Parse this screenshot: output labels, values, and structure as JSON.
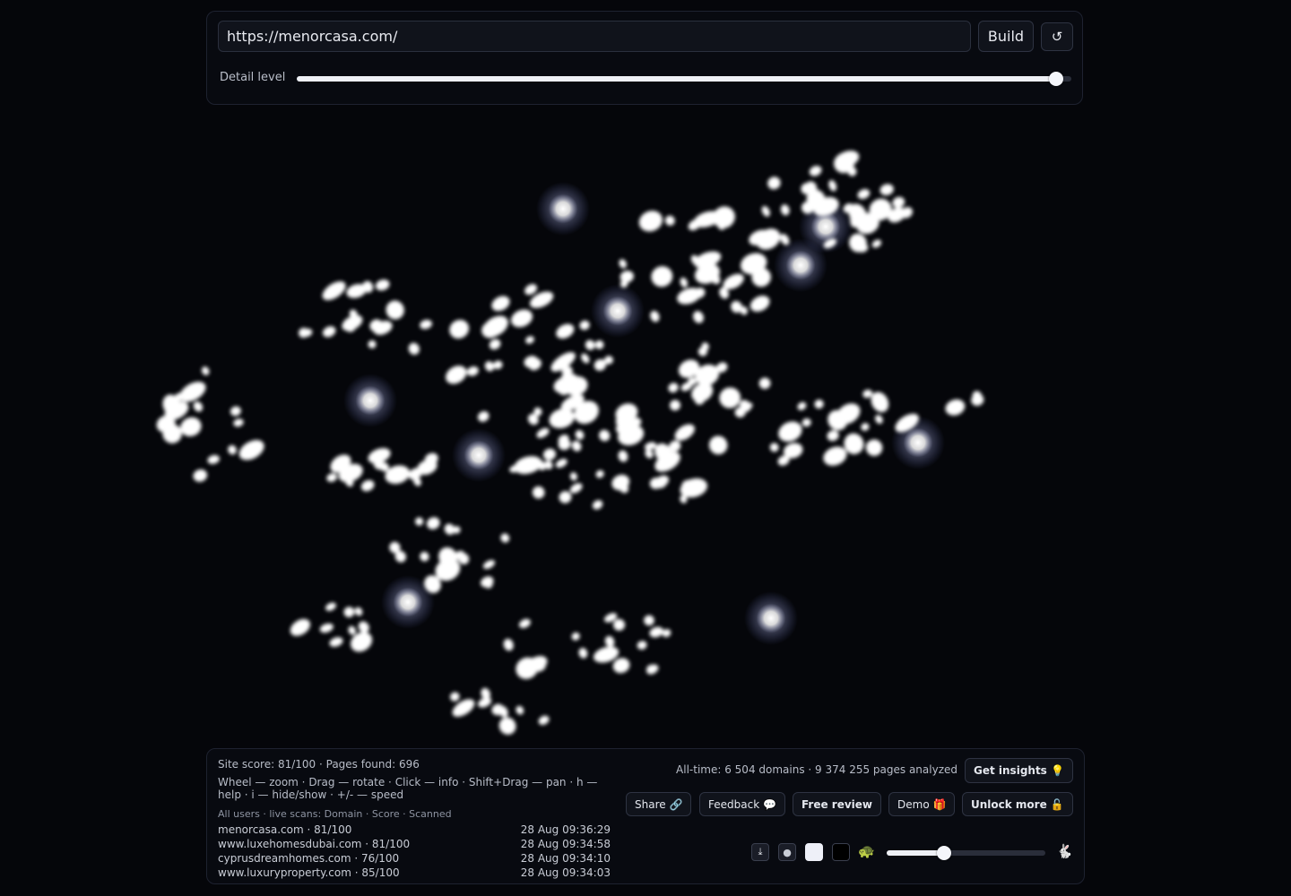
{
  "url_bar": {
    "value": "https://menorcasa.com/"
  },
  "toolbar": {
    "build_label": "Build",
    "refresh_icon": "↺"
  },
  "detail": {
    "label": "Detail level",
    "level": 0.98
  },
  "stats": {
    "site_score": "Site score: 81/100 · Pages found: 696",
    "help": "Wheel — zoom · Drag — rotate · Click — info · Shift+Drag — pan · h — help · i — hide/show · +/- — speed",
    "all_time": "All-time: 6 504 domains · 9 374 255 pages analyzed"
  },
  "scans": {
    "header": "All users · live scans: Domain · Score · Scanned",
    "rows": [
      {
        "domain": "menorcasa.com · 81/100",
        "time": "28 Aug 09:36:29"
      },
      {
        "domain": "www.luxehomesdubai.com · 81/100",
        "time": "28 Aug 09:34:58"
      },
      {
        "domain": "cyprusdreamhomes.com · 76/100",
        "time": "28 Aug 09:34:10"
      },
      {
        "domain": "www.luxuryproperty.com · 85/100",
        "time": "28 Aug 09:34:03"
      }
    ]
  },
  "actions": {
    "insights": "Get insights 💡",
    "share": "Share 🔗",
    "feedback": "Feedback 💬",
    "review": "Free review",
    "demo": "Demo 🎁",
    "unlock": "Unlock more 🔓"
  },
  "controls": {
    "download_icon": "⤓",
    "dot_icon": "●",
    "slow_icon": "🐢",
    "fast_icon": "🐇",
    "speed_level": 0.36
  },
  "colors": {
    "background": "#05060a",
    "node": "#ffffff",
    "glow": "#aab4ff"
  }
}
